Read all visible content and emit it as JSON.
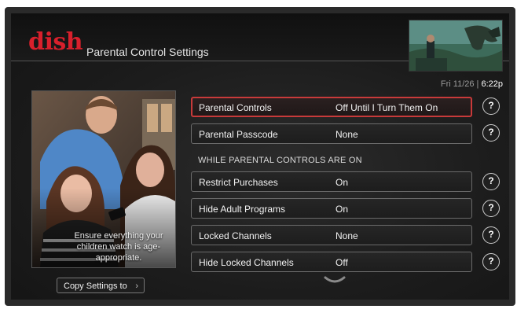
{
  "header": {
    "logo_text": "dish",
    "title": "Parental Control Settings"
  },
  "clock": {
    "date": "Fri 11/26",
    "separator": "|",
    "time": "6:22p"
  },
  "promo": {
    "caption": "Ensure everything your children watch is age-appropriate."
  },
  "copy_button": {
    "label": "Copy Settings to",
    "chevron": "›"
  },
  "section_header": "WHILE PARENTAL CONTROLS ARE ON",
  "settings": [
    {
      "label": "Parental Controls",
      "value": "Off Until I Turn Them On",
      "help": "?"
    },
    {
      "label": "Parental Passcode",
      "value": "None",
      "help": "?"
    },
    {
      "label": "Restrict Purchases",
      "value": "On",
      "help": "?"
    },
    {
      "label": "Hide Adult Programs",
      "value": "On",
      "help": "?"
    },
    {
      "label": "Locked Channels",
      "value": "None",
      "help": "?"
    },
    {
      "label": "Hide Locked Channels",
      "value": "Off",
      "help": "?"
    }
  ],
  "colors": {
    "accent_red": "#d8202c",
    "selected_border": "#c83a3a"
  },
  "icons": {
    "help": "question-circle-icon",
    "scroll_more": "chevron-down-icon",
    "copy_chevron": "chevron-right-icon"
  }
}
